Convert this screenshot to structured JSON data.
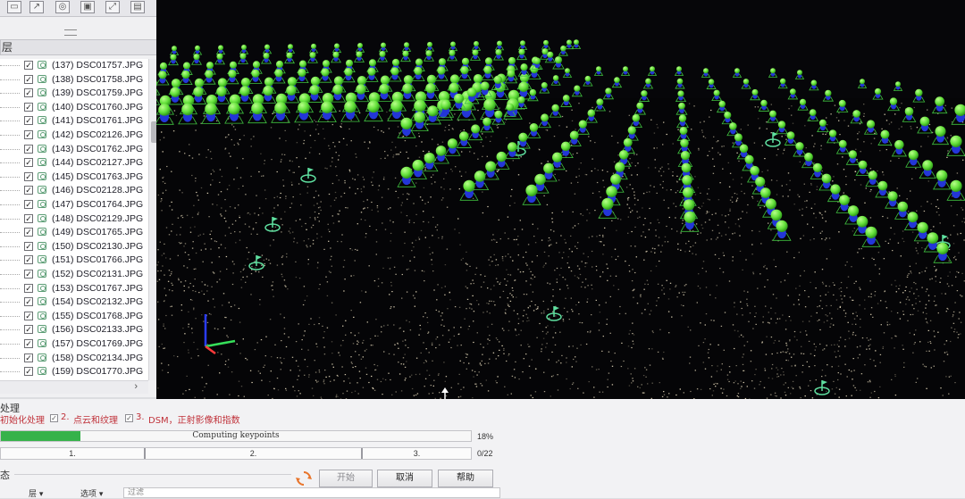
{
  "panel": {
    "header": "层",
    "images": [
      {
        "index": "(137)",
        "name": "DSC01757.JPG"
      },
      {
        "index": "(138)",
        "name": "DSC01758.JPG"
      },
      {
        "index": "(139)",
        "name": "DSC01759.JPG"
      },
      {
        "index": "(140)",
        "name": "DSC01760.JPG"
      },
      {
        "index": "(141)",
        "name": "DSC01761.JPG"
      },
      {
        "index": "(142)",
        "name": "DSC02126.JPG"
      },
      {
        "index": "(143)",
        "name": "DSC01762.JPG"
      },
      {
        "index": "(144)",
        "name": "DSC02127.JPG"
      },
      {
        "index": "(145)",
        "name": "DSC01763.JPG"
      },
      {
        "index": "(146)",
        "name": "DSC02128.JPG"
      },
      {
        "index": "(147)",
        "name": "DSC01764.JPG"
      },
      {
        "index": "(148)",
        "name": "DSC02129.JPG"
      },
      {
        "index": "(149)",
        "name": "DSC01765.JPG"
      },
      {
        "index": "(150)",
        "name": "DSC02130.JPG"
      },
      {
        "index": "(151)",
        "name": "DSC01766.JPG"
      },
      {
        "index": "(152)",
        "name": "DSC02131.JPG"
      },
      {
        "index": "(153)",
        "name": "DSC01767.JPG"
      },
      {
        "index": "(154)",
        "name": "DSC02132.JPG"
      },
      {
        "index": "(155)",
        "name": "DSC01768.JPG"
      },
      {
        "index": "(156)",
        "name": "DSC02133.JPG"
      },
      {
        "index": "(157)",
        "name": "DSC01769.JPG"
      },
      {
        "index": "(158)",
        "name": "DSC02134.JPG"
      },
      {
        "index": "(159)",
        "name": "DSC01770.JPG"
      }
    ],
    "scroll_arrow": "›"
  },
  "processing": {
    "title": "处理",
    "steps": [
      {
        "number": "",
        "label": "初始化处理",
        "checked": true
      },
      {
        "number": "2.",
        "label": "点云和纹理",
        "checked": true
      },
      {
        "number": "3.",
        "label": "DSM，正射影像和指数",
        "checked": true
      }
    ],
    "progress_text": "Computing keypoints",
    "progress_value": 0.17,
    "progress_percent": "18%",
    "stages": [
      "1.",
      "2.",
      "3."
    ],
    "stage_count": "0/22",
    "status_label": "态",
    "buttons": {
      "start": "开始",
      "cancel": "取消",
      "help": "帮助"
    },
    "bottom": {
      "layer_select": "层",
      "options_select": "选项",
      "filter_placeholder": "过滤"
    }
  },
  "colors": {
    "progress": "#36b24a",
    "camera_sphere": "#63e03a",
    "camera_base": "#2336d8",
    "error_text": "#c0323a"
  },
  "icons": [
    "layers-icon",
    "camera-icon",
    "refresh-icon",
    "axis-gizmo-icon",
    "resize-cursor-icon"
  ]
}
